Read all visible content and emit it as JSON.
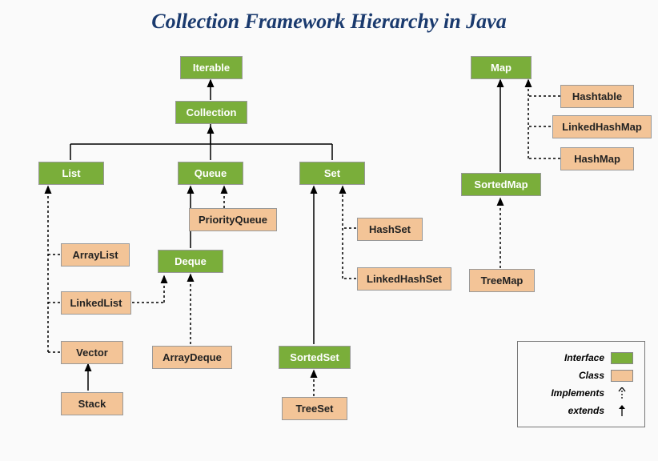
{
  "title": "Collection Framework Hierarchy in Java",
  "nodes": {
    "iterable": "Iterable",
    "collection": "Collection",
    "list": "List",
    "queue": "Queue",
    "set": "Set",
    "deque": "Deque",
    "sortedset": "SortedSet",
    "arraylist": "ArrayList",
    "linkedlist": "LinkedList",
    "vector": "Vector",
    "stack": "Stack",
    "priorityqueue": "PriorityQueue",
    "arraydeque": "ArrayDeque",
    "hashset": "HashSet",
    "linkedhashset": "LinkedHashSet",
    "treeset": "TreeSet",
    "map": "Map",
    "sortedmap": "SortedMap",
    "hashtable": "Hashtable",
    "linkedhashmap": "LinkedHashMap",
    "hashmap": "HashMap",
    "treemap": "TreeMap"
  },
  "legend": {
    "interface": "Interface",
    "class": "Class",
    "implements": "Implements",
    "extends": "extends"
  },
  "colors": {
    "interface": "#7aae3a",
    "class": "#f3c497",
    "title": "#1a3a6e"
  },
  "chart_data": {
    "type": "hierarchy-diagram",
    "title": "Collection Framework Hierarchy in Java",
    "node_types": [
      "interface",
      "class"
    ],
    "edge_types": [
      "extends",
      "implements"
    ],
    "nodes": [
      {
        "id": "Iterable",
        "type": "interface"
      },
      {
        "id": "Collection",
        "type": "interface"
      },
      {
        "id": "List",
        "type": "interface"
      },
      {
        "id": "Queue",
        "type": "interface"
      },
      {
        "id": "Set",
        "type": "interface"
      },
      {
        "id": "Deque",
        "type": "interface"
      },
      {
        "id": "SortedSet",
        "type": "interface"
      },
      {
        "id": "Map",
        "type": "interface"
      },
      {
        "id": "SortedMap",
        "type": "interface"
      },
      {
        "id": "ArrayList",
        "type": "class"
      },
      {
        "id": "LinkedList",
        "type": "class"
      },
      {
        "id": "Vector",
        "type": "class"
      },
      {
        "id": "Stack",
        "type": "class"
      },
      {
        "id": "PriorityQueue",
        "type": "class"
      },
      {
        "id": "ArrayDeque",
        "type": "class"
      },
      {
        "id": "HashSet",
        "type": "class"
      },
      {
        "id": "LinkedHashSet",
        "type": "class"
      },
      {
        "id": "TreeSet",
        "type": "class"
      },
      {
        "id": "Hashtable",
        "type": "class"
      },
      {
        "id": "LinkedHashMap",
        "type": "class"
      },
      {
        "id": "HashMap",
        "type": "class"
      },
      {
        "id": "TreeMap",
        "type": "class"
      }
    ],
    "edges": [
      {
        "from": "Collection",
        "to": "Iterable",
        "rel": "extends"
      },
      {
        "from": "List",
        "to": "Collection",
        "rel": "extends"
      },
      {
        "from": "Queue",
        "to": "Collection",
        "rel": "extends"
      },
      {
        "from": "Set",
        "to": "Collection",
        "rel": "extends"
      },
      {
        "from": "Deque",
        "to": "Queue",
        "rel": "extends"
      },
      {
        "from": "SortedSet",
        "to": "Set",
        "rel": "extends"
      },
      {
        "from": "SortedMap",
        "to": "Map",
        "rel": "extends"
      },
      {
        "from": "ArrayList",
        "to": "List",
        "rel": "implements"
      },
      {
        "from": "LinkedList",
        "to": "List",
        "rel": "implements"
      },
      {
        "from": "LinkedList",
        "to": "Deque",
        "rel": "implements"
      },
      {
        "from": "Vector",
        "to": "List",
        "rel": "implements"
      },
      {
        "from": "Stack",
        "to": "Vector",
        "rel": "extends"
      },
      {
        "from": "PriorityQueue",
        "to": "Queue",
        "rel": "implements"
      },
      {
        "from": "ArrayDeque",
        "to": "Deque",
        "rel": "implements"
      },
      {
        "from": "HashSet",
        "to": "Set",
        "rel": "implements"
      },
      {
        "from": "LinkedHashSet",
        "to": "Set",
        "rel": "implements"
      },
      {
        "from": "TreeSet",
        "to": "SortedSet",
        "rel": "implements"
      },
      {
        "from": "Hashtable",
        "to": "Map",
        "rel": "implements"
      },
      {
        "from": "LinkedHashMap",
        "to": "Map",
        "rel": "implements"
      },
      {
        "from": "HashMap",
        "to": "Map",
        "rel": "implements"
      },
      {
        "from": "TreeMap",
        "to": "SortedMap",
        "rel": "implements"
      }
    ]
  }
}
